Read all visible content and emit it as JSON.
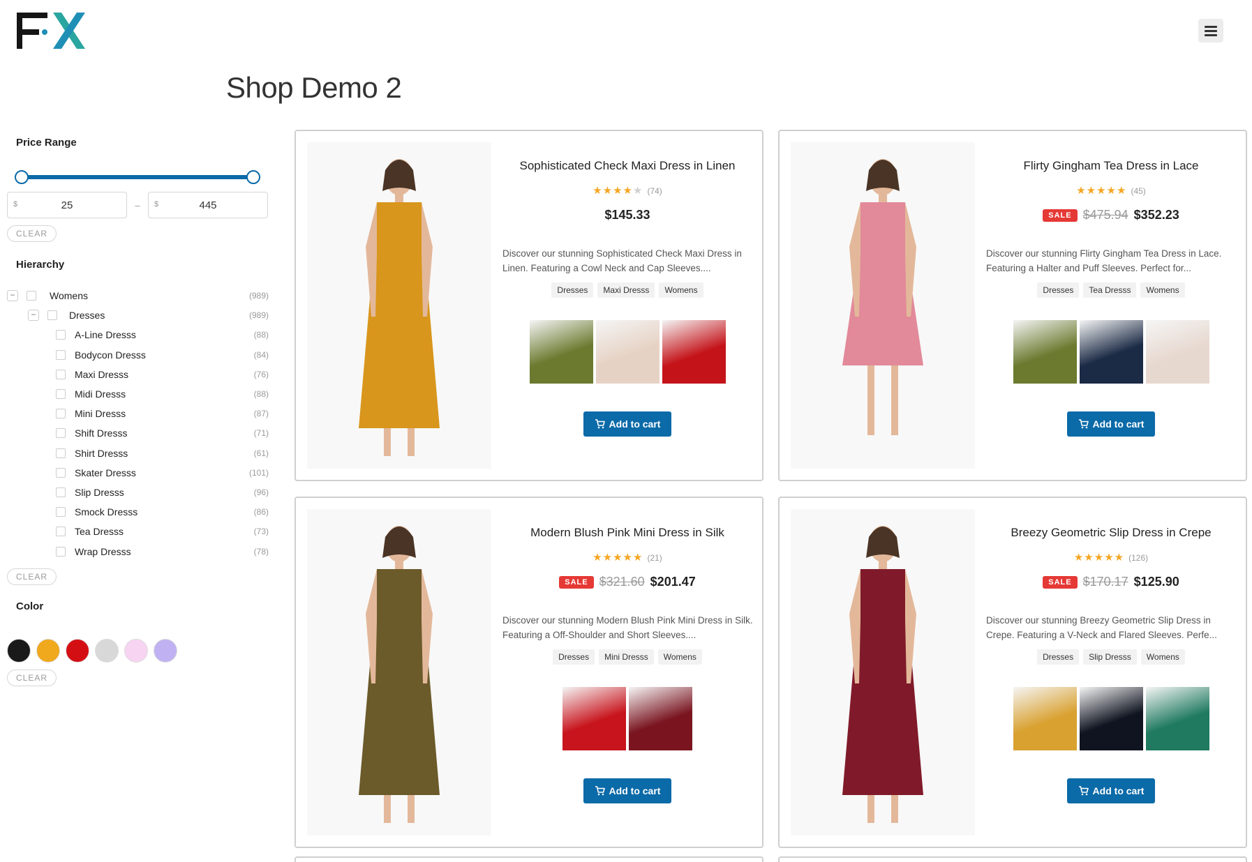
{
  "header": {
    "page_title": "Shop Demo 2"
  },
  "filters": {
    "price_range": {
      "title": "Price Range",
      "currency_symbol": "$",
      "min_value": "25",
      "max_value": "445",
      "separator": "–",
      "clear_label": "CLEAR"
    },
    "hierarchy": {
      "title": "Hierarchy",
      "clear_label": "CLEAR",
      "root": {
        "label": "Womens",
        "count": "(989)",
        "toggle": "−"
      },
      "child": {
        "label": "Dresses",
        "count": "(989)",
        "toggle": "−"
      },
      "items": [
        {
          "label": "A-Line Dresss",
          "count": "(88)"
        },
        {
          "label": "Bodycon Dresss",
          "count": "(84)"
        },
        {
          "label": "Maxi Dresss",
          "count": "(76)"
        },
        {
          "label": "Midi Dresss",
          "count": "(88)"
        },
        {
          "label": "Mini Dresss",
          "count": "(87)"
        },
        {
          "label": "Shift Dresss",
          "count": "(71)"
        },
        {
          "label": "Shirt Dresss",
          "count": "(61)"
        },
        {
          "label": "Skater Dresss",
          "count": "(101)"
        },
        {
          "label": "Slip Dresss",
          "count": "(96)"
        },
        {
          "label": "Smock Dresss",
          "count": "(86)"
        },
        {
          "label": "Tea Dresss",
          "count": "(73)"
        },
        {
          "label": "Wrap Dresss",
          "count": "(78)"
        }
      ]
    },
    "color": {
      "title": "Color",
      "clear_label": "CLEAR",
      "swatches": [
        "#1a1a1a",
        "#f0a81c",
        "#d40f14",
        "#d8d8d8",
        "#f7d4f2",
        "#c0b2f2"
      ]
    }
  },
  "products": [
    {
      "title": "Sophisticated Check Maxi Dress in Linen",
      "stars": "★★★",
      "half": "★",
      "empty": "★",
      "rating_count": "(74)",
      "on_sale": false,
      "old_price": "",
      "price": "$145.33",
      "description": "Discover our stunning Sophisticated Check Maxi Dress in Linen. Featuring a Cowl Neck and Cap Sleeves....",
      "tags": [
        "Dresses",
        "Maxi Dresss",
        "Womens"
      ],
      "thumb_colors": [
        "#6b7a2f",
        "#e6d2c4",
        "#c4141a"
      ],
      "dress_color": "#d8961c",
      "cart_label": "Add to cart"
    },
    {
      "title": "Flirty Gingham Tea Dress in Lace",
      "stars": "★★★★",
      "half": "★",
      "empty": "",
      "rating_count": "(45)",
      "on_sale": true,
      "sale_label": "SALE",
      "old_price": "$475.94",
      "price": "$352.23",
      "description": "Discover our stunning Flirty Gingham Tea Dress in Lace. Featuring a Halter and Puff Sleeves. Perfect for...",
      "tags": [
        "Dresses",
        "Tea Dresss",
        "Womens"
      ],
      "thumb_colors": [
        "#6b7a2f",
        "#1b2a45",
        "#e7d8cf"
      ],
      "dress_color": "#e2899a",
      "cart_label": "Add to cart"
    },
    {
      "title": "Modern Blush Pink Mini Dress in Silk",
      "stars": "★★★★",
      "half": "★",
      "empty": "",
      "rating_count": "(21)",
      "on_sale": true,
      "sale_label": "SALE",
      "old_price": "$321.60",
      "price": "$201.47",
      "description": "Discover our stunning Modern Blush Pink Mini Dress in Silk. Featuring a Off-Shoulder and Short Sleeves....",
      "tags": [
        "Dresses",
        "Mini Dresss",
        "Womens"
      ],
      "thumb_colors": [
        "#c8141c",
        "#7a1520"
      ],
      "dress_color": "#6b5a2a",
      "cart_label": "Add to cart"
    },
    {
      "title": "Breezy Geometric Slip Dress in Crepe",
      "stars": "★★★★",
      "half": "★",
      "empty": "",
      "rating_count": "(126)",
      "on_sale": true,
      "sale_label": "SALE",
      "old_price": "$170.17",
      "price": "$125.90",
      "description": "Discover our stunning Breezy Geometric Slip Dress in Crepe. Featuring a V-Neck and Flared Sleeves. Perfe...",
      "tags": [
        "Dresses",
        "Slip Dresss",
        "Womens"
      ],
      "thumb_colors": [
        "#d9a130",
        "#0f1420",
        "#1f7a5f"
      ],
      "dress_color": "#801a2a",
      "cart_label": "Add to cart"
    }
  ]
}
